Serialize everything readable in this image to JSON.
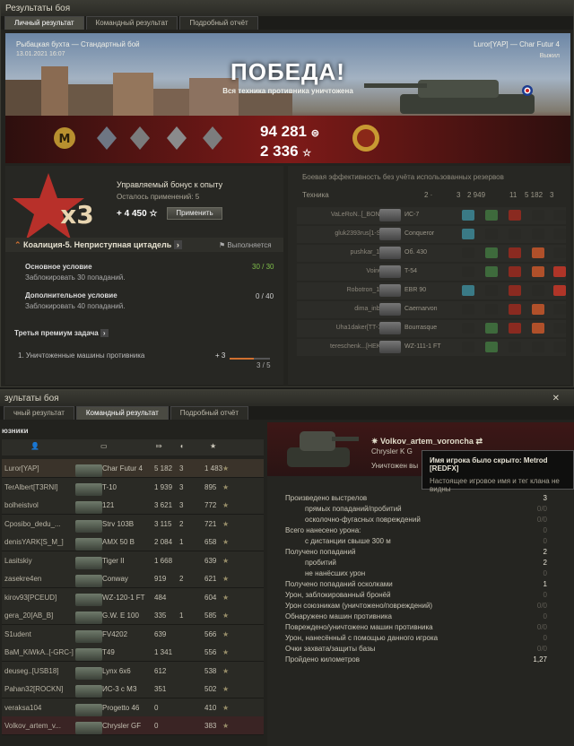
{
  "top": {
    "window_title": "Результаты боя",
    "tabs": [
      "Личный результат",
      "Командный результат",
      "Подробный отчёт"
    ],
    "battle": "Рыбацкая бухта — Стандартный бой",
    "date": "13.01.2021 16:07",
    "player": "Luror[YAP] — Char Futur 4",
    "status": "Выжил",
    "victory": "ПОБЕДА!",
    "victory_sub": "Вся техника противника уничтожена",
    "credits": "94 281",
    "xp": "2 336",
    "bonus_title": "Управляемый бонус к опыту",
    "bonus_left": "Осталось применений: 5",
    "bonus_value": "+ 4 450",
    "apply": "Применить",
    "x3": "x3",
    "mission": "Коалиция-5. Неприступная цитадель",
    "mission_status": "Выполняется",
    "main_cond": "Основное условие",
    "main_desc": "Заблокировать 30 попаданий.",
    "main_prog": "30 / 30",
    "add_cond": "Дополнительное условие",
    "add_desc": "Заблокировать 40 попаданий.",
    "add_prog": "0 / 40",
    "third": "Третья премиум задача",
    "third_task": "1. Уничтоженные машины противника",
    "third_bonus": "+ 3",
    "third_prog": "3 / 5",
    "eff_title": "Боевая эффективность без учёта использованных резервов",
    "eff_header": [
      "Техника",
      "2 ·",
      "3",
      "2 949",
      "11",
      "5 182",
      "3"
    ],
    "eff_rows": [
      {
        "player": "VaLeRoN..[_BONG]",
        "tank": "ИС-7"
      },
      {
        "player": "gluk2393rus[1-SK]",
        "tank": "Conqueror"
      },
      {
        "player": "pushkar_137",
        "tank": "Об. 430"
      },
      {
        "player": "VoinCh",
        "tank": "T-54"
      },
      {
        "player": "Robotron_124",
        "tank": "EBR 90"
      },
      {
        "player": "dima_inbox",
        "tank": "Caernarvon"
      },
      {
        "player": "Uha1daker[TT-72]",
        "tank": "Bourrasque"
      },
      {
        "player": "tereschenk...[HEKP]",
        "tank": "WZ-111-1 FT"
      }
    ]
  },
  "bottom": {
    "window_title": "зультаты боя",
    "tabs": [
      "чный результат",
      "Командный результат",
      "Подробный отчёт"
    ],
    "allies": "юзники",
    "rows": [
      {
        "player": "Luror[YAP]",
        "tank": "Char Futur 4",
        "dmg": "5 182",
        "kills": "3",
        "xp": "1 483"
      },
      {
        "player": "TerAlbert[T3RNI]",
        "tank": "T-10",
        "dmg": "1 939",
        "kills": "3",
        "xp": "895"
      },
      {
        "player": "bolheistvol",
        "tank": "121",
        "dmg": "3 621",
        "kills": "3",
        "xp": "772"
      },
      {
        "player": "Cposibo_dedu_...",
        "tank": "Strv 103B",
        "dmg": "3 115",
        "kills": "2",
        "xp": "721"
      },
      {
        "player": "denisYARK[S_M_]",
        "tank": "AMX 50 B",
        "dmg": "2 084",
        "kills": "1",
        "xp": "658"
      },
      {
        "player": "Lasitskiy",
        "tank": "Tiger II",
        "dmg": "1 668",
        "kills": "",
        "xp": "639"
      },
      {
        "player": "zasekre4en",
        "tank": "Conway",
        "dmg": "919",
        "kills": "2",
        "xp": "621"
      },
      {
        "player": "kirov93[PCEUD]",
        "tank": "WZ-120-1 FT",
        "dmg": "484",
        "kills": "",
        "xp": "604"
      },
      {
        "player": "gera_20[AB_B]",
        "tank": "G.W. E 100",
        "dmg": "335",
        "kills": "1",
        "xp": "585"
      },
      {
        "player": "S1udent",
        "tank": "FV4202",
        "dmg": "639",
        "kills": "",
        "xp": "566"
      },
      {
        "player": "BaM_KiWkA..[-GRC-]",
        "tank": "T49",
        "dmg": "1 341",
        "kills": "",
        "xp": "556"
      },
      {
        "player": "deuseg..[USB18]",
        "tank": "Lynx 6x6",
        "dmg": "612",
        "kills": "",
        "xp": "538"
      },
      {
        "player": "Pahan32[ROCKN]",
        "tank": "ИС-3 с МЗ",
        "dmg": "351",
        "kills": "",
        "xp": "502"
      },
      {
        "player": "veraksa104",
        "tank": "Progetto 46",
        "dmg": "0",
        "kills": "",
        "xp": "410"
      },
      {
        "player": "Volkov_artem_v...",
        "tank": "Chrysler GF",
        "dmg": "0",
        "kills": "",
        "xp": "383"
      }
    ],
    "detail_player": "Volkov_artem_voroncha",
    "detail_tank": "Chrysler K G",
    "detail_status": "Уничтожен вы",
    "stats": [
      {
        "l": "Произведено выстрелов",
        "v": "3"
      },
      {
        "l": "прямых попаданий/пробитий",
        "v": "0/0"
      },
      {
        "l": "осколочно-фугасных повреждений",
        "v": "0/0"
      },
      {
        "l": "Всего нанесено урона:",
        "v": "0"
      },
      {
        "l": "с дистанции свыше 300 м",
        "v": "0"
      },
      {
        "l": "Получено попаданий",
        "v": "2"
      },
      {
        "l": "пробитий",
        "v": "2"
      },
      {
        "l": "не нанёсших урон",
        "v": "0"
      },
      {
        "l": "Получено попаданий осколками",
        "v": "1"
      },
      {
        "l": "Урон, заблокированный бронёй",
        "v": "0"
      },
      {
        "l": "Урон союзникам (уничтожено/повреждений)",
        "v": "0/0"
      },
      {
        "l": "Обнаружено машин противника",
        "v": "0"
      },
      {
        "l": "Повреждено/уничтожено машин противника",
        "v": "0/0"
      },
      {
        "l": "Урон, нанесённый с помощью данного игрока",
        "v": "0"
      },
      {
        "l": "Очки захвата/защиты базы",
        "v": "0/0"
      },
      {
        "l": "Пройдено километров",
        "v": "1,27"
      }
    ],
    "tip_title": "Имя игрока было скрыто: Metrod [REDFX]",
    "tip_text": "Настоящее игровое имя и тег клана не видны"
  }
}
